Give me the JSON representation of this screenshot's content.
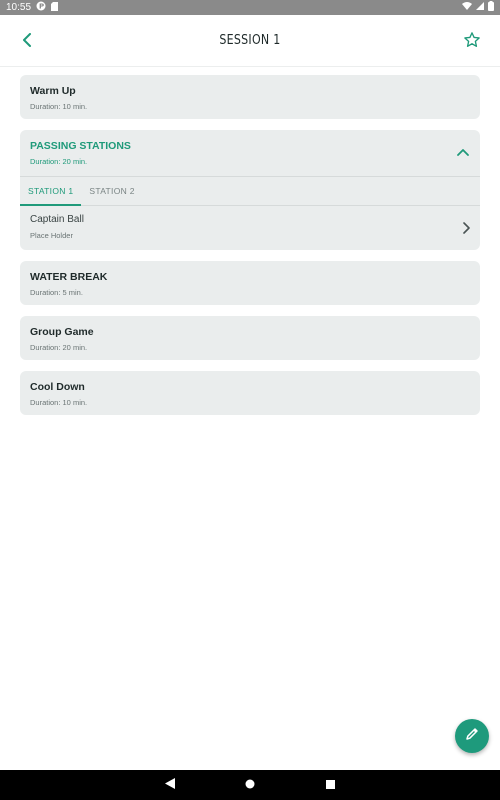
{
  "status_bar": {
    "time": "10:55"
  },
  "header": {
    "title": "SESSION 1"
  },
  "items": [
    {
      "title": "Warm Up",
      "subtitle": "Duration: 10 min."
    },
    {
      "title": "PASSING STATIONS",
      "subtitle": "Duration: 20 min.",
      "tabs": [
        "STATION 1",
        "STATION 2"
      ],
      "sub_items": [
        {
          "title": "Captain Ball",
          "subtitle": "Place Holder"
        }
      ]
    },
    {
      "title": "WATER BREAK",
      "subtitle": "Duration: 5 min."
    },
    {
      "title": "Group Game",
      "subtitle": "Duration: 20 min."
    },
    {
      "title": "Cool Down",
      "subtitle": "Duration: 10 min."
    }
  ],
  "colors": {
    "accent": "#1f9a7a",
    "card_bg": "#eaeded",
    "fab": "#1e9a7c",
    "status_bar": "#8a8a8a"
  },
  "icons": [
    "back-arrow-icon",
    "star-outline-icon",
    "chevron-up-icon",
    "chevron-right-icon",
    "pencil-icon",
    "nav-back-icon",
    "nav-home-icon",
    "nav-recents-icon"
  ]
}
